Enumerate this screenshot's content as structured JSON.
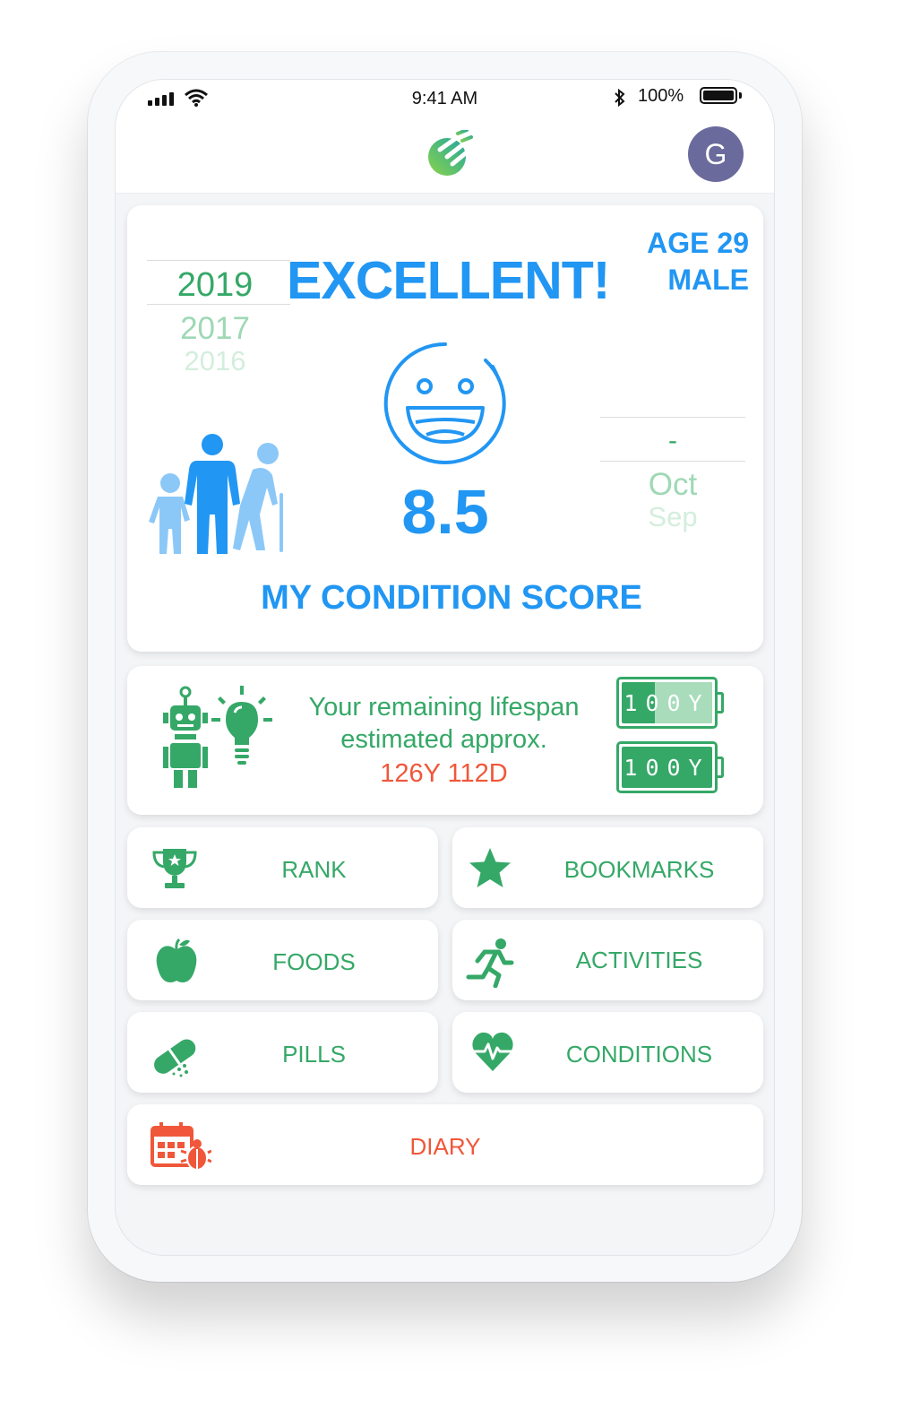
{
  "status_bar": {
    "time": "9:41 AM",
    "battery": "100%"
  },
  "header": {
    "avatar_initial": "G"
  },
  "score_card": {
    "years": [
      "2019",
      "2017",
      "2016"
    ],
    "headline": "EXCELLENT!",
    "age": "AGE 29",
    "gender": "MALE",
    "score": "8.5",
    "months": [
      "-",
      "Oct",
      "Sep"
    ],
    "title": "MY CONDITION SCORE"
  },
  "lifespan": {
    "line1": "Your remaining lifespan",
    "line2": "estimated approx.",
    "value": "126Y  112D",
    "battery_top": "100Y",
    "battery_bottom": "100Y",
    "battery_top_level": 0.37,
    "battery_bottom_level": 1.0
  },
  "menu": {
    "rank": "RANK",
    "bookmarks": "BOOKMARKS",
    "foods": "FOODS",
    "activities": "ACTIVITIES",
    "pills": "PILLS",
    "conditions": "CONDITIONS",
    "diary": "DIARY"
  },
  "colors": {
    "primary_blue": "#2196f3",
    "green": "#35a867",
    "orange": "#f0573a",
    "avatar": "#6b6a9c"
  }
}
